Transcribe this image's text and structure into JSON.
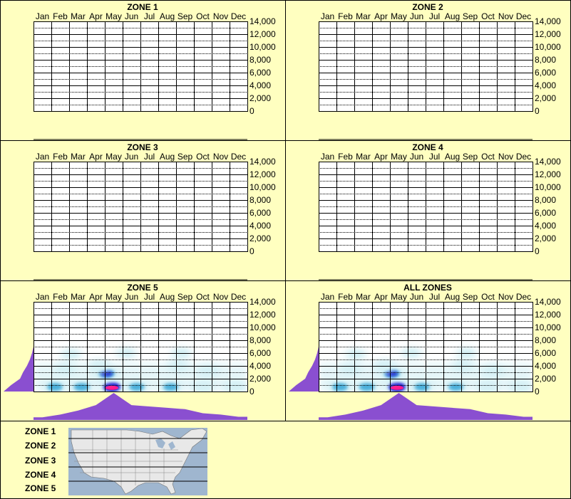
{
  "months": [
    "Jan",
    "Feb",
    "Mar",
    "Apr",
    "May",
    "Jun",
    "Jul",
    "Aug",
    "Sep",
    "Oct",
    "Nov",
    "Dec"
  ],
  "y_ticks": [
    "14,000",
    "12,000",
    "10,000",
    "8,000",
    "6,000",
    "4,000",
    "2,000",
    "0"
  ],
  "legend": {
    "zones": [
      "ZONE 1",
      "ZONE 2",
      "ZONE 3",
      "ZONE 4",
      "ZONE 5"
    ]
  },
  "colors": {
    "background": "#ffffc0",
    "grid": "#000000",
    "profile": "#8a4fd0",
    "heat_low": "#d6f1f6",
    "heat_mid": "#3aa8d8",
    "heat_high": "#1010d0",
    "heat_peak": "#ff1a8c"
  },
  "chart_data": [
    {
      "type": "heatmap",
      "title": "ZONE 1",
      "ylim": [
        0,
        14000
      ],
      "has_data": false
    },
    {
      "type": "heatmap",
      "title": "ZONE 2",
      "ylim": [
        0,
        14000
      ],
      "has_data": false
    },
    {
      "type": "heatmap",
      "title": "ZONE 3",
      "ylim": [
        0,
        14000
      ],
      "has_data": false
    },
    {
      "type": "heatmap",
      "title": "ZONE 4",
      "ylim": [
        0,
        14000
      ],
      "has_data": false
    },
    {
      "type": "heatmap",
      "title": "ZONE 5",
      "ylim": [
        0,
        14000
      ],
      "has_data": true,
      "monthly_profile": [
        0.1,
        0.2,
        0.35,
        0.55,
        1.0,
        0.55,
        0.5,
        0.45,
        0.4,
        0.25,
        0.2,
        0.12
      ],
      "elevation_profile": [
        1.0,
        0.75,
        0.45,
        0.35,
        0.22,
        0.12,
        0.05,
        0.0
      ],
      "blobs": [
        {
          "month": 3.9,
          "elev": 700,
          "intensity": 1.0
        },
        {
          "month": 3.6,
          "elev": 2800,
          "intensity": 0.85
        },
        {
          "month": 0.7,
          "elev": 700,
          "intensity": 0.75
        },
        {
          "month": 2.2,
          "elev": 700,
          "intensity": 0.75
        },
        {
          "month": 5.3,
          "elev": 700,
          "intensity": 0.7
        },
        {
          "month": 7.2,
          "elev": 700,
          "intensity": 0.65
        },
        {
          "month": 9.0,
          "elev": 700,
          "intensity": 0.6
        },
        {
          "month": 10.8,
          "elev": 700,
          "intensity": 0.55
        },
        {
          "month": 1.3,
          "elev": 3500,
          "intensity": 0.5
        },
        {
          "month": 3.2,
          "elev": 4000,
          "intensity": 0.45
        },
        {
          "month": 7.6,
          "elev": 4000,
          "intensity": 0.45
        },
        {
          "month": 9.3,
          "elev": 3200,
          "intensity": 0.4
        },
        {
          "month": 1.6,
          "elev": 5800,
          "intensity": 0.25
        },
        {
          "month": 4.7,
          "elev": 6000,
          "intensity": 0.25
        },
        {
          "month": 7.8,
          "elev": 6000,
          "intensity": 0.2
        }
      ]
    },
    {
      "type": "heatmap",
      "title": "ALL ZONES",
      "ylim": [
        0,
        14000
      ],
      "has_data": true,
      "monthly_profile": [
        0.1,
        0.2,
        0.35,
        0.55,
        1.0,
        0.55,
        0.5,
        0.45,
        0.4,
        0.25,
        0.2,
        0.12
      ],
      "elevation_profile": [
        1.0,
        0.75,
        0.45,
        0.35,
        0.22,
        0.12,
        0.05,
        0.0
      ],
      "blobs": [
        {
          "month": 3.9,
          "elev": 700,
          "intensity": 1.0
        },
        {
          "month": 3.6,
          "elev": 2800,
          "intensity": 0.85
        },
        {
          "month": 0.7,
          "elev": 700,
          "intensity": 0.75
        },
        {
          "month": 2.2,
          "elev": 700,
          "intensity": 0.75
        },
        {
          "month": 5.3,
          "elev": 700,
          "intensity": 0.7
        },
        {
          "month": 7.2,
          "elev": 700,
          "intensity": 0.65
        },
        {
          "month": 9.0,
          "elev": 700,
          "intensity": 0.6
        },
        {
          "month": 10.8,
          "elev": 700,
          "intensity": 0.55
        },
        {
          "month": 1.3,
          "elev": 3500,
          "intensity": 0.5
        },
        {
          "month": 3.2,
          "elev": 4000,
          "intensity": 0.45
        },
        {
          "month": 7.6,
          "elev": 4000,
          "intensity": 0.45
        },
        {
          "month": 9.3,
          "elev": 3200,
          "intensity": 0.4
        },
        {
          "month": 1.6,
          "elev": 5800,
          "intensity": 0.25
        },
        {
          "month": 4.7,
          "elev": 6000,
          "intensity": 0.25
        },
        {
          "month": 7.8,
          "elev": 6000,
          "intensity": 0.2
        }
      ]
    }
  ]
}
